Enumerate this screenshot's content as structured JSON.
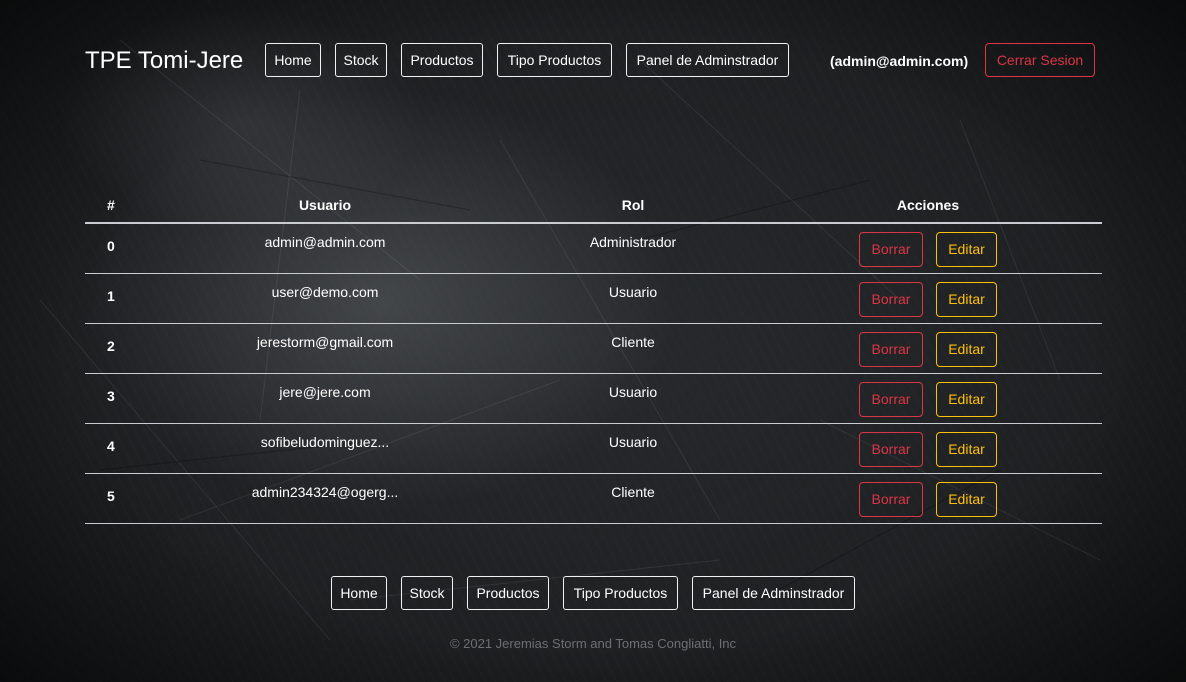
{
  "header": {
    "brand": "TPE Tomi-Jere",
    "nav": [
      "Home",
      "Stock",
      "Productos",
      "Tipo Productos",
      "Panel de Adminstrador"
    ],
    "user_email": "(admin@admin.com)",
    "logout_label": "Cerrar Sesion",
    "logout_color": "#dc3545"
  },
  "table": {
    "columns": [
      "#",
      "Usuario",
      "Rol",
      "Acciones"
    ],
    "rows": [
      {
        "index": "0",
        "usuario": "admin@admin.com",
        "rol": "Administrador"
      },
      {
        "index": "1",
        "usuario": "user@demo.com",
        "rol": "Usuario"
      },
      {
        "index": "2",
        "usuario": "jerestorm@gmail.com",
        "rol": "Cliente"
      },
      {
        "index": "3",
        "usuario": "jere@jere.com",
        "rol": "Usuario"
      },
      {
        "index": "4",
        "usuario": "sofibeludominguez...",
        "rol": "Usuario"
      },
      {
        "index": "5",
        "usuario": "admin234324@ogerg...",
        "rol": "Cliente"
      }
    ],
    "delete_label": "Borrar",
    "edit_label": "Editar",
    "delete_color": "#dc3545",
    "edit_color": "#ffc107"
  },
  "footer": {
    "nav": [
      "Home",
      "Stock",
      "Productos",
      "Tipo Productos",
      "Panel de Adminstrador"
    ],
    "copyright": "© 2021 Jeremias Storm and Tomas Congliatti, Inc"
  }
}
